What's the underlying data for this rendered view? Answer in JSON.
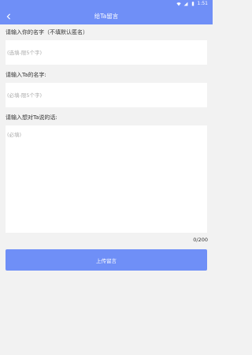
{
  "status_bar": {
    "time": "1:51",
    "icons": [
      "wifi-icon",
      "signal-icon",
      "battery-icon"
    ]
  },
  "header": {
    "title": "给Ta留言",
    "back_icon": "chevron-left-icon"
  },
  "form": {
    "your_name_label": "请输入你的名字（不填默认匿名）",
    "your_name_placeholder": "(选填-限5个字)",
    "their_name_label": "请输入Ta的名字:",
    "their_name_placeholder": "(必填-限5个字)",
    "message_label": "请输入想对Ta说的话:",
    "message_placeholder": "(必填)",
    "counter": "0/200",
    "submit_label": "上传留言"
  },
  "colors": {
    "accent": "#6f8ff7",
    "background": "#f2f2f2"
  }
}
